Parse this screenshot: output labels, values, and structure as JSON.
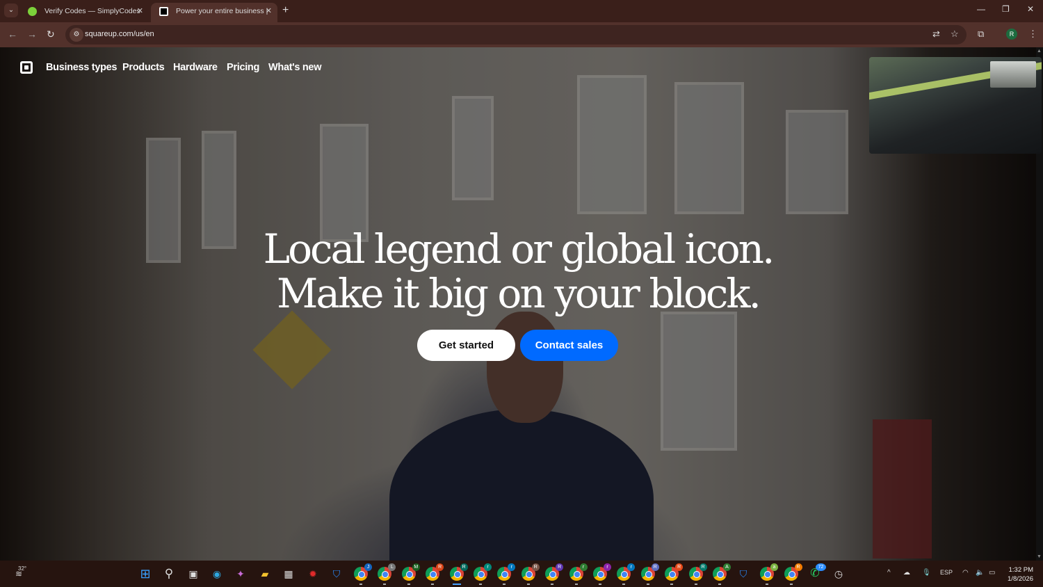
{
  "browser": {
    "tabs": [
      {
        "title": "Verify Codes — SimplyCodes",
        "favicon": "simplycodes-icon"
      },
      {
        "title": "Power your entire business | Sq",
        "favicon": "square-icon",
        "active": true
      }
    ],
    "url": "squareup.com/us/en",
    "profile_initial": "R"
  },
  "site": {
    "nav": [
      "Business types",
      "Products",
      "Hardware",
      "Pricing",
      "What's new"
    ],
    "headline_line1": "Local legend or global icon.",
    "headline_line2": "Make it big on your block.",
    "cta_primary": "Get started",
    "cta_secondary": "Contact sales",
    "accent_color": "#006aff"
  },
  "taskbar": {
    "weather": "32°",
    "chrome_profiles": [
      {
        "letter": "J",
        "color": "#1565c0"
      },
      {
        "letter": "L",
        "color": "#777777"
      },
      {
        "letter": "M",
        "color": "#1b5e20"
      },
      {
        "letter": "R",
        "color": "#d84315"
      },
      {
        "letter": "R",
        "color": "#00695c",
        "active": true
      },
      {
        "letter": "r",
        "color": "#00897b"
      },
      {
        "letter": "r",
        "color": "#0277bd"
      },
      {
        "letter": "R",
        "color": "#795548"
      },
      {
        "letter": "R",
        "color": "#5e35b1"
      },
      {
        "letter": "r",
        "color": "#2e7d32"
      },
      {
        "letter": "r",
        "color": "#8e24aa"
      },
      {
        "letter": "r",
        "color": "#0277bd"
      },
      {
        "letter": "R",
        "color": "#5c6bc0"
      },
      {
        "letter": "R",
        "color": "#e64a19"
      },
      {
        "letter": "R",
        "color": "#00796b"
      },
      {
        "letter": "A",
        "color": "#2e7d32"
      }
    ],
    "chrome_profiles2": [
      {
        "letter": "a",
        "color": "#7cb342"
      },
      {
        "letter": "R",
        "color": "#f57c00"
      }
    ],
    "whatsapp_badge": "72",
    "language": "ESP",
    "time": "1:32 PM",
    "date": "1/8/2026"
  }
}
